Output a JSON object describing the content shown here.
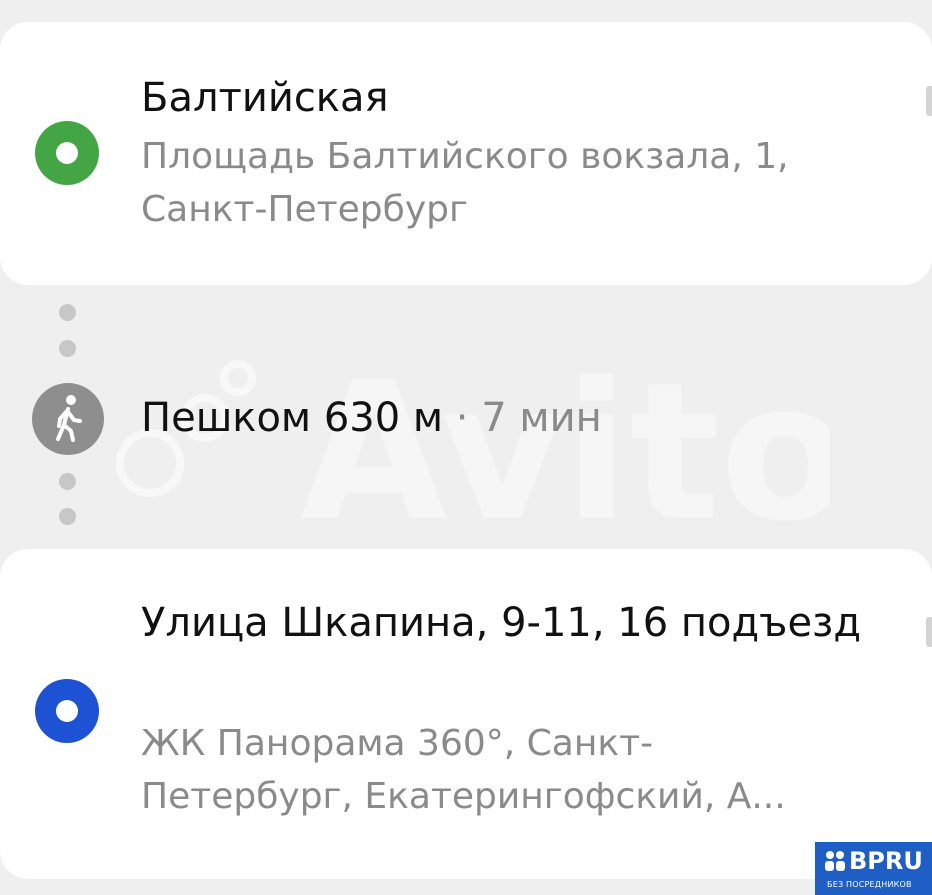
{
  "start_stop": {
    "name": "Балтийская",
    "address": "Площадь Балтийского вокзала, 1, Санкт-Петербург",
    "pin_color": "#44a544"
  },
  "walking": {
    "mode_label": "Пешком",
    "distance": "630 м",
    "separator": "·",
    "duration": "7 мин",
    "icon": "pedestrian-icon"
  },
  "destination": {
    "name": "Улица Шкапина, 9-11, 16 подъезд",
    "address": "ЖК Панорама 360°, Санкт-Петербург, Екатерингофский, А...",
    "pin_color": "#1d52d4"
  },
  "watermark": {
    "text": "Avito"
  },
  "badge": {
    "logo": "BPRU",
    "tagline": "БЕЗ ПОСРЕДНИКОВ",
    "color": "#1f5fc5"
  }
}
